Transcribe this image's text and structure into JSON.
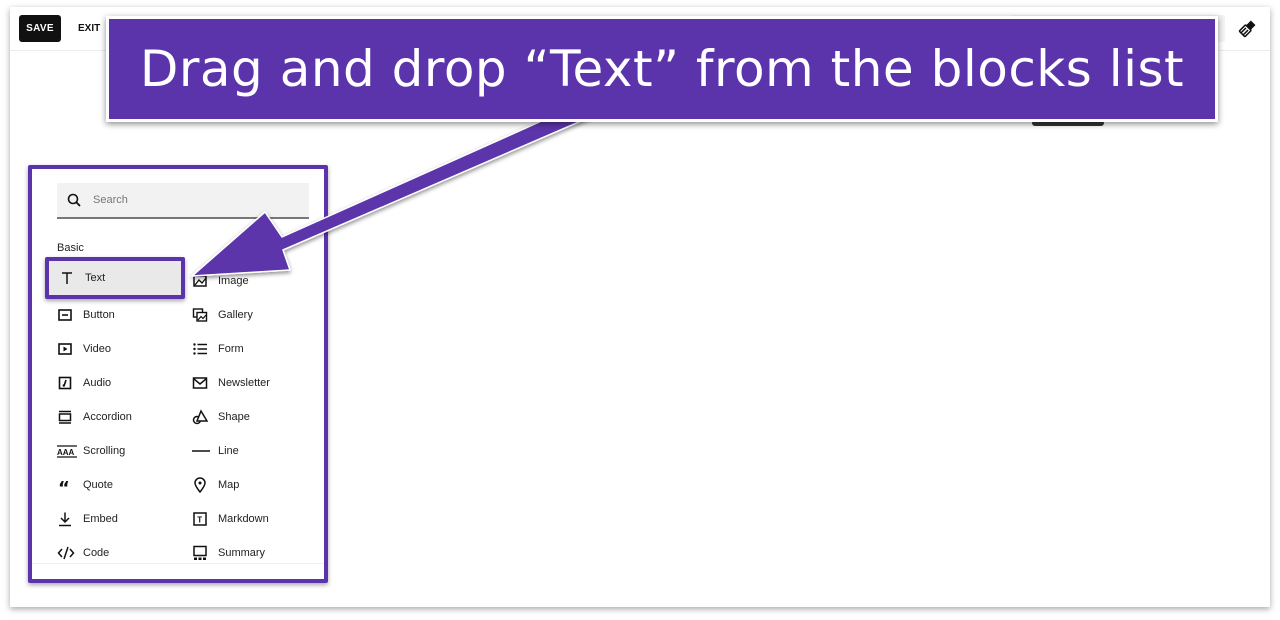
{
  "toolbar": {
    "save_label": "SAVE",
    "exit_label": "EXIT",
    "style_icon": "paintbrush-icon"
  },
  "callout": {
    "text": "Drag and drop “Text” from the blocks list",
    "color": "#5b34ab"
  },
  "blocks_panel": {
    "search": {
      "placeholder": "Search",
      "value": ""
    },
    "section": "Basic",
    "left_column": [
      {
        "label": "Text",
        "icon": "text-t-icon",
        "highlighted": true
      },
      {
        "label": "Button",
        "icon": "button-icon"
      },
      {
        "label": "Video",
        "icon": "video-icon"
      },
      {
        "label": "Audio",
        "icon": "audio-icon"
      },
      {
        "label": "Accordion",
        "icon": "accordion-icon"
      },
      {
        "label": "Scrolling",
        "icon": "scrolling-icon"
      },
      {
        "label": "Quote",
        "icon": "quote-icon"
      },
      {
        "label": "Embed",
        "icon": "embed-icon"
      },
      {
        "label": "Code",
        "icon": "code-icon"
      }
    ],
    "right_column": [
      {
        "label": "Image",
        "icon": "image-icon"
      },
      {
        "label": "Gallery",
        "icon": "gallery-icon"
      },
      {
        "label": "Form",
        "icon": "form-icon"
      },
      {
        "label": "Newsletter",
        "icon": "newsletter-icon"
      },
      {
        "label": "Shape",
        "icon": "shape-icon"
      },
      {
        "label": "Line",
        "icon": "line-icon"
      },
      {
        "label": "Map",
        "icon": "map-pin-icon"
      },
      {
        "label": "Markdown",
        "icon": "markdown-icon"
      },
      {
        "label": "Summary",
        "icon": "summary-icon"
      }
    ]
  }
}
